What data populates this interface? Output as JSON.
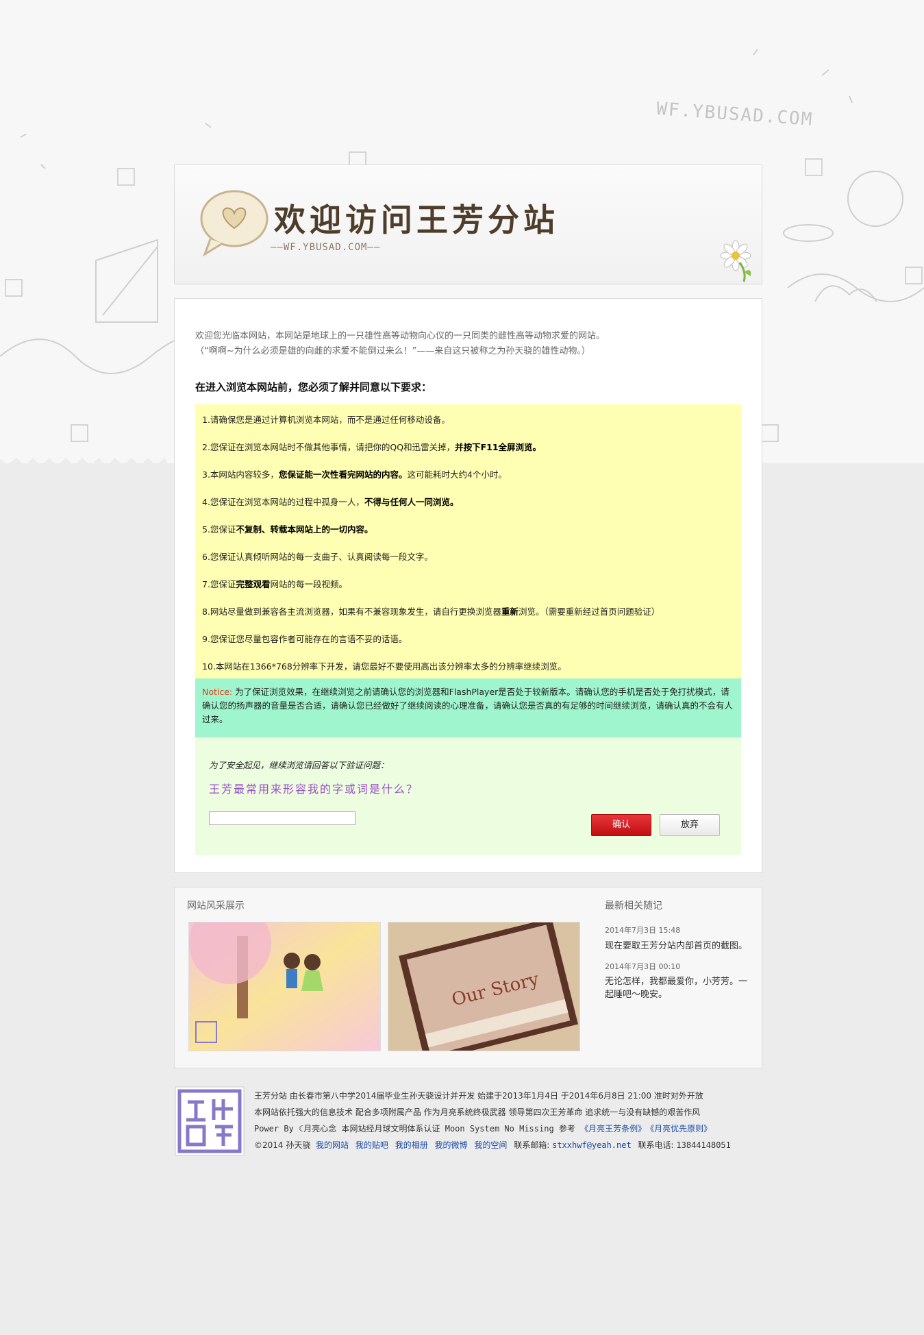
{
  "background": {
    "watermark": "WF.YBUSAD.COM"
  },
  "header": {
    "title": "欢迎访问王芳分站",
    "subtitle": "——WF.YBUSAD.COM——"
  },
  "intro": {
    "line1": "欢迎您光临本网站，本网站是地球上的一只雄性高等动物向心仪的一只同类的雌性高等动物求爱的网站。",
    "line2": "（“啊啊~为什么必须是雄的向雌的求爱不能倒过来么！”——来自这只被称之为孙天骁的雄性动物。）"
  },
  "requirements": {
    "title": "在进入浏览本网站前，您必须了解并同意以下要求：",
    "items": [
      {
        "pre": "1.请确保您是通过计算机浏览本网站，而不是通过任何移动设备。",
        "bold": "",
        "post": ""
      },
      {
        "pre": "2.您保证在浏览本网站时不做其他事情，请把你的QQ和迅雷关掉，",
        "bold": "并按下F11全屏浏览。",
        "post": ""
      },
      {
        "pre": "3.本网站内容较多，",
        "bold": "您保证能一次性看完网站的内容。",
        "post": "这可能耗时大约4个小时。"
      },
      {
        "pre": "4.您保证在浏览本网站的过程中孤身一人，",
        "bold": "不得与任何人一同浏览。",
        "post": ""
      },
      {
        "pre": "5.您保证",
        "bold": "不复制、转载本网站上的一切内容。",
        "post": ""
      },
      {
        "pre": "6.您保证认真倾听网站的每一支曲子、认真阅读每一段文字。",
        "bold": "",
        "post": ""
      },
      {
        "pre": "7.您保证",
        "bold": "完整观看",
        "post": "网站的每一段视频。"
      },
      {
        "pre": "8.网站尽量做到兼容各主流浏览器，如果有不兼容现象发生，请自行更换浏览器",
        "bold": "重新",
        "post": "浏览。（需要重新经过首页问题验证）"
      },
      {
        "pre": "9.您保证您尽量包容作者可能存在的言语不妥的话语。",
        "bold": "",
        "post": ""
      },
      {
        "pre": "10.本网站在1366*768分辨率下开发，请您最好不要使用高出该分辨率太多的分辨率继续浏览。",
        "bold": "",
        "post": ""
      }
    ]
  },
  "notice": {
    "label": "Notice:",
    "text": " 为了保证浏览效果，在继续浏览之前请确认您的浏览器和FlashPlayer是否处于较新版本。请确认您的手机是否处于免打扰模式，请确认您的扬声器的音量是否合适，请确认您已经做好了继续阅读的心理准备，请确认您是否真的有足够的时间继续浏览，请确认真的不会有人过来。"
  },
  "verify": {
    "hint": "为了安全起见，继续浏览请回答以下验证问题：",
    "question": "王芳最常用来形容我的字或词是什么？",
    "answer_value": "",
    "confirm_label": "确认",
    "cancel_label": "放弃"
  },
  "gallery": {
    "title": "网站风采展示",
    "book_text": "Our Story"
  },
  "news": {
    "title": "最新相关随记",
    "items": [
      {
        "date": "2014年7月3日 15:48",
        "text": "现在要取王芳分站内部首页的截图。"
      },
      {
        "date": "2014年7月3日 00:10",
        "text": "无论怎样，我都最爱你，小芳芳。一起睡吧～晚安。"
      }
    ]
  },
  "footer": {
    "line1": "王芳分站 由长春市第八中学2014届毕业生孙天骁设计并开发 始建于2013年1月4日 于2014年6月8日 21:00 准时对外开放",
    "line2": "本网站依托强大的信息技术 配合多项附属产品 作为月亮系统终极武器 领导第四次王芳革命 追求统一与没有缺憾的艰苦作风",
    "line3_pre": "Power By ",
    "line3_brand": "月亮心念",
    "line3_mid": " 本网站经月球文明体系认证 Moon System No Missing 参考 ",
    "line3_link1": "《月亮王芳条例》",
    "line3_link2": "《月亮优先原则》",
    "line4_copy": "©2014 孙天骁",
    "links": [
      "我的网站",
      "我的贴吧",
      "我的相册",
      "我的微博",
      "我的空间"
    ],
    "email_label": "联系邮箱:",
    "email": "stxxhwf@yeah.net",
    "phone_label": "联系电话:",
    "phone": "13844148051"
  }
}
